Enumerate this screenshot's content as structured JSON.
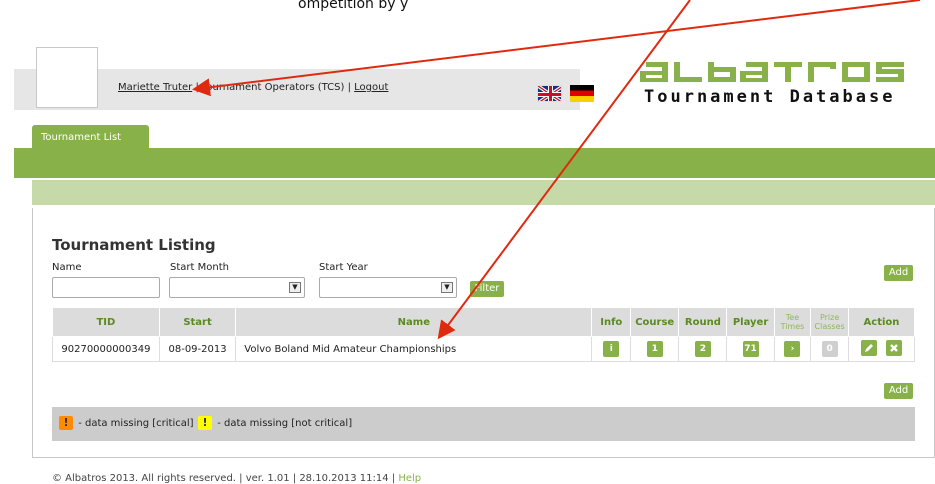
{
  "caption": "ompetition by y",
  "header": {
    "user_name": "Mariette Truter",
    "separator": "|",
    "role": "Tournament Operators (TCS)",
    "logout": "Logout",
    "brand_sub": "Tournament Database",
    "logo": "albatros"
  },
  "tabs": [
    {
      "label": "Tournament List"
    }
  ],
  "listing": {
    "title": "Tournament Listing",
    "filters": {
      "name_label": "Name",
      "name_value": "",
      "month_label": "Start Month",
      "month_value": "",
      "year_label": "Start Year",
      "year_value": "",
      "filter_button": "Filter",
      "add_button": "Add"
    },
    "columns": [
      "TID",
      "Start",
      "Name",
      "Info",
      "Course",
      "Round",
      "Player",
      "Tee Times",
      "Prize Classes",
      "Action"
    ],
    "rows": [
      {
        "tid": "90270000000349",
        "start": "08-09-2013",
        "name": "Volvo Boland Mid Amateur Championships",
        "info": "i",
        "course": "1",
        "round": "2",
        "player": "71",
        "tee_times": "›",
        "prize_classes": "0"
      }
    ],
    "add_bottom": "Add"
  },
  "legend": {
    "critical_symbol": "!",
    "critical_text": "- data missing [critical]",
    "noncritical_symbol": "!",
    "noncritical_text": "- data missing [not critical]"
  },
  "footer": {
    "text": "© Albatros 2013. All rights reserved. | ver. 1.01 | 28.10.2013 11:14 |",
    "help": "Help"
  },
  "colors": {
    "accent": "#88b14a",
    "light_accent": "#c5daa8",
    "critical": "#ff8c00",
    "noncritical": "#ffff00",
    "arrow": "#e02a10"
  },
  "icons": {
    "info": "info-icon",
    "tee_times": "chevron-right-icon",
    "edit": "pencil-icon",
    "delete": "close-icon"
  }
}
